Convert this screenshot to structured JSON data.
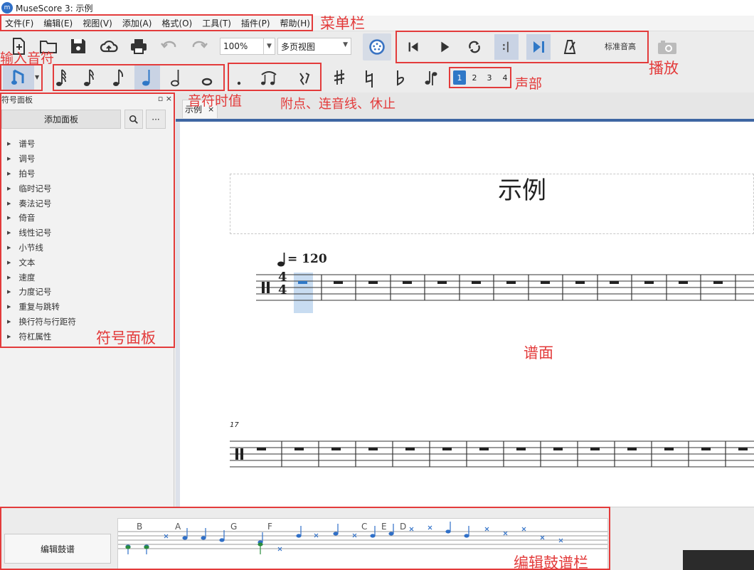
{
  "window": {
    "logo_text": "m",
    "title": "MuseScore 3: 示例"
  },
  "menu": [
    "文件(F)",
    "编辑(E)",
    "视图(V)",
    "添加(A)",
    "格式(O)",
    "工具(T)",
    "插件(P)",
    "帮助(H)"
  ],
  "toolbar": {
    "zoom": "100%",
    "view_mode": "多页视图",
    "concert_pitch": "标准音高"
  },
  "voices": [
    "1",
    "2",
    "3",
    "4"
  ],
  "palette": {
    "title": "符号面板",
    "header_controls": "▫ ×",
    "add_palette": "添加面板",
    "more": "···",
    "items": [
      "谱号",
      "调号",
      "拍号",
      "临时记号",
      "奏法记号",
      "倚音",
      "线性记号",
      "小节线",
      "文本",
      "速度",
      "力度记号",
      "重复与跳转",
      "换行符与行距符",
      "符杠属性"
    ]
  },
  "tab": {
    "label": "示例",
    "close": "×"
  },
  "score": {
    "title": "示例",
    "tempo": "= 120",
    "time_sig_top": "4",
    "time_sig_bottom": "4",
    "measure_number": "17"
  },
  "drum": {
    "edit_label": "编辑鼓谱",
    "letters": [
      "B",
      "A",
      "G",
      "F",
      "C",
      "E",
      "D"
    ]
  },
  "annotations": {
    "menubar": "菜单栏",
    "input": "输入音符",
    "durations": "音符时值",
    "dots": "附点、连音线、休止",
    "voices": "声部",
    "playback": "播放",
    "palette": "符号面板",
    "score": "谱面",
    "drum": "编辑鼓谱栏"
  },
  "colors": {
    "annotation": "#e33b3b",
    "accent": "#2f78c7",
    "selection": "#c9d3e4"
  }
}
